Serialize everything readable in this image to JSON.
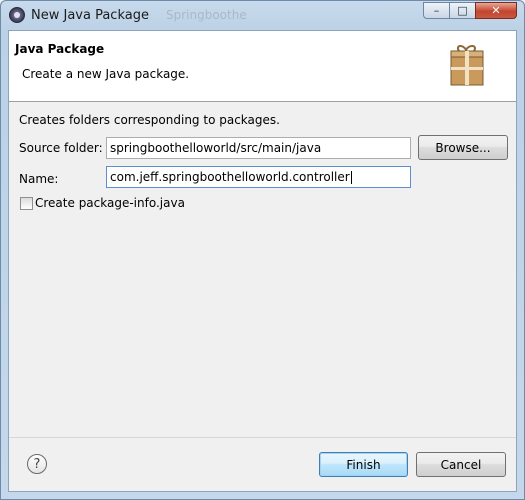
{
  "window": {
    "title": "New Java Package",
    "background_title": "Springboothe",
    "minimize_glyph": "–",
    "maximize_glyph": "□",
    "close_glyph": "✕"
  },
  "header": {
    "title": "Java Package",
    "description": "Create a new Java package.",
    "icon": "package-icon"
  },
  "form": {
    "description": "Creates folders corresponding to packages.",
    "source_folder_label": "Source folder:",
    "source_folder_value": "springboothelloworld/src/main/java",
    "browse_label": "Browse...",
    "name_label": "Name:",
    "name_value": "com.jeff.springboothelloworld.controller",
    "create_package_info_label": "Create package-info.java",
    "create_package_info_checked": false
  },
  "footer": {
    "help_glyph": "?",
    "finish_label": "Finish",
    "cancel_label": "Cancel"
  },
  "colors": {
    "titlebar": "#c3d6ea",
    "close_button": "#c4452f",
    "default_button_border": "#3c7fb1",
    "package_icon": "#c99a5b"
  }
}
